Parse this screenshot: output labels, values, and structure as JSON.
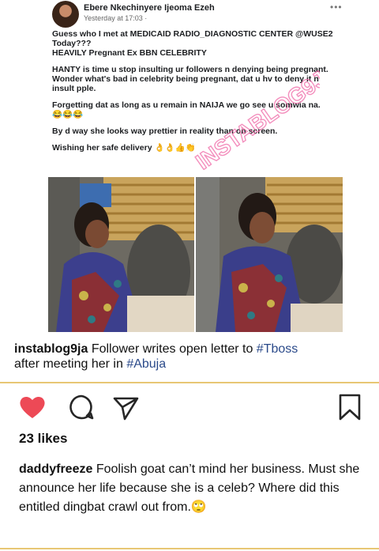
{
  "fb_post": {
    "author": "Ebere Nkechinyere Ijeoma Ezeh",
    "timestamp": "Yesterday at 17:03 ·",
    "more_icon": "•••",
    "lines": [
      "Guess who I met at MEDICAID RADIO_DIAGNOSTIC CENTER @WUSE2",
      "Today???",
      "HEAVILY Pregnant Ex BBN CELEBRITY",
      "",
      "HANTY is time u stop insulting ur followers n denying being pregnant.",
      "Wonder what's bad in celebrity being pregnant, dat u hv to deny it n",
      "insult pple.",
      "",
      "Forgetting dat as long as u remain in NAIJA we go see u somwia na.",
      "😂😂😂",
      "",
      "By d way she looks way prettier in reality than on screen.",
      "",
      "Wishing her safe delivery 👌👌👍👏"
    ],
    "watermark": "INSTABLOG9JA"
  },
  "caption": {
    "username": "instablog9ja",
    "text_before": "Follower writes open letter to",
    "hashtag1": "#Tboss",
    "text_middle": "after meeting her in",
    "hashtag2": "#Abuja"
  },
  "actions": {
    "like_icon": "heart-filled-icon",
    "comment_icon": "comment-bubble-icon",
    "share_icon": "paper-plane-icon",
    "save_icon": "bookmark-icon",
    "like_color": "#ed4956"
  },
  "likes": {
    "label": "23 likes"
  },
  "comment": {
    "username": "daddyfreeze",
    "text": "Foolish goat can’t mind her business. Must she announce her life because she is a celeb? Where did this entitled dingbat crawl out from.🙄"
  }
}
